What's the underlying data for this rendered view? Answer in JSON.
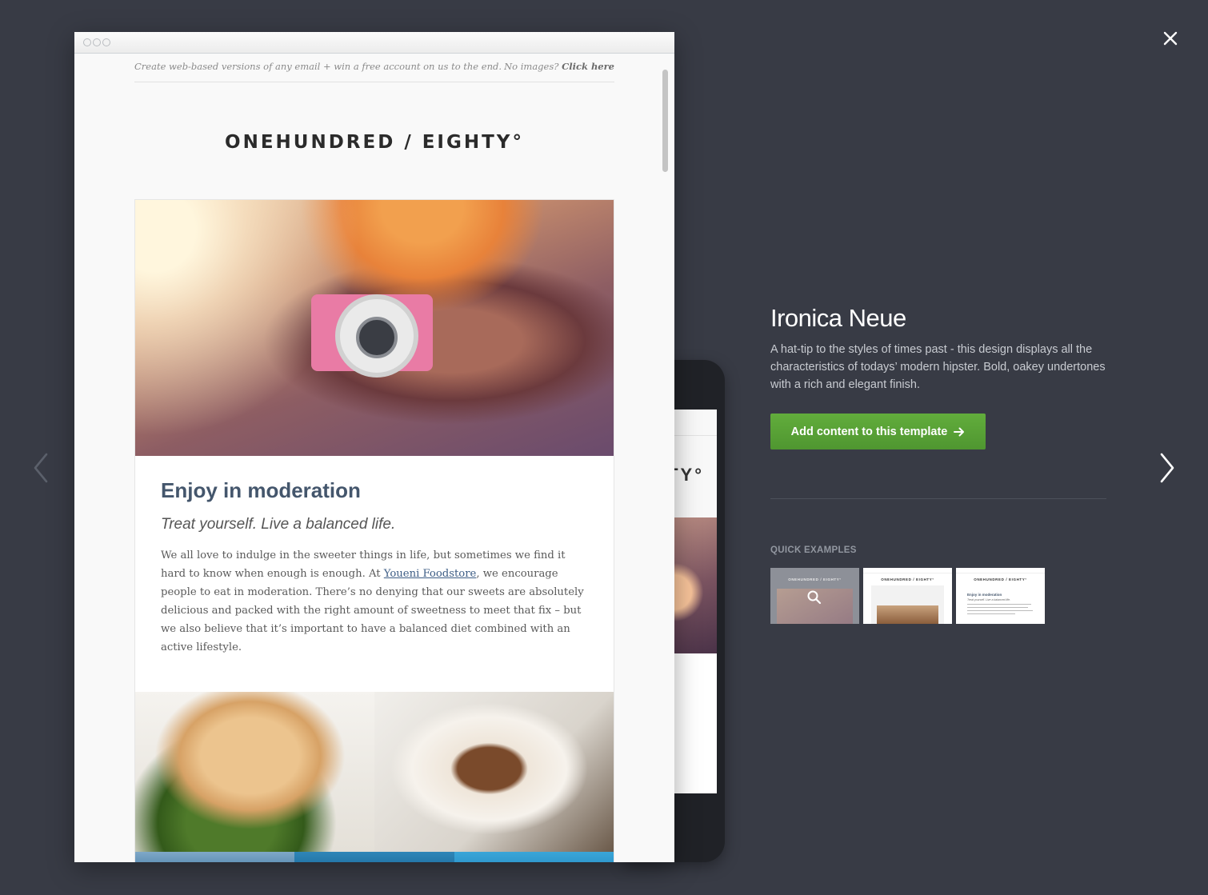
{
  "close_icon": "close-icon",
  "nav": {
    "prev_icon": "chevron-left-icon",
    "next_icon": "chevron-right-icon"
  },
  "email": {
    "preheader_left": "Create web-based versions of any email + win a free account on us to the end.",
    "preheader_right_prefix": "No images?",
    "preheader_right_link": "Click here",
    "logo_text": "ONEHUNDRED / EIGHTY°",
    "headline": "Enjoy in moderation",
    "subheadline": "Treat yourself. Live a balanced life.",
    "body_before_link": "We all love to indulge in the sweeter things in life, but sometimes we find it hard to know when enough is enough. At ",
    "body_link": "Youeni Foodstore",
    "body_after_link": ", we encourage people to eat in moderation. There’s no denying that our sweets are absolutely delicious and packed with the right amount of sweetness to meet that fix – but we also believe that it’s important to have a balanced diet combined with an active lifestyle."
  },
  "phone": {
    "logo_fragment": "EIGHTY°"
  },
  "template": {
    "title": "Ironica Neue",
    "description": "A hat-tip to the styles of times past - this design displays all the characteristics of todays’ modern hipster. Bold, oakey undertones with a rich and elegant finish.",
    "cta_label": "Add content to this template",
    "cta_icon": "arrow-right-icon",
    "quick_examples_label": "QUICK EXAMPLES",
    "thumbnails": [
      {
        "logo": "ONEHUNDRED / EIGHTY°",
        "icon": "search-icon"
      },
      {
        "logo": "ONEHUNDRED / EIGHTY°"
      },
      {
        "logo": "ONEHUNDRED / EIGHTY°",
        "headline": "Enjoy in moderation",
        "subheadline": "Treat yourself. Live a balanced life."
      }
    ]
  },
  "colors": {
    "background": "#383b45",
    "cta_green": "#58a135",
    "headline_blue": "#44566c",
    "link_blue": "#3d5d85"
  }
}
